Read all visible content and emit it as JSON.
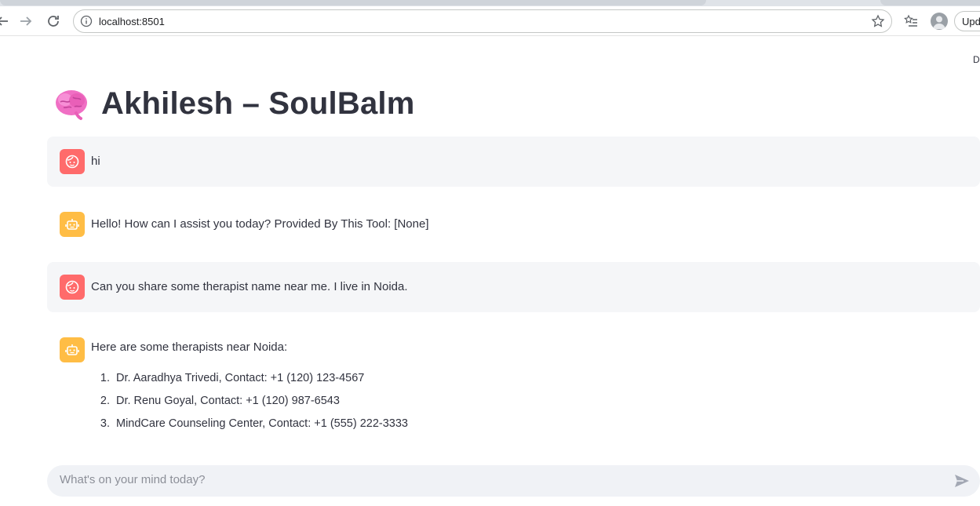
{
  "browser": {
    "url": "localhost:8501",
    "update_label": "Upd"
  },
  "app": {
    "deploy_label": "De",
    "title": "Akhilesh – SoulBalm",
    "title_icon": "brain-emoji"
  },
  "messages": [
    {
      "role": "user",
      "text": "hi"
    },
    {
      "role": "assistant",
      "text": "Hello! How can I assist you today? Provided By This Tool: [None]"
    },
    {
      "role": "user",
      "text": "Can you share some therapist name near me. I live in Noida."
    },
    {
      "role": "assistant",
      "text": "Here are some therapists near Noida:"
    }
  ],
  "therapists": [
    {
      "num": "1.",
      "text": "Dr. Aaradhya Trivedi, Contact: +1 (120) 123-4567"
    },
    {
      "num": "2.",
      "text": "Dr. Renu Goyal, Contact: +1 (120) 987-6543"
    },
    {
      "num": "3.",
      "text": "MindCare Counseling Center, Contact: +1 (555) 222-3333"
    }
  ],
  "chat_input": {
    "placeholder": "What's on your mind today?"
  },
  "colors": {
    "user_avatar": "#ff6b6b",
    "assistant_avatar": "#ffbd45",
    "user_bubble": "#f5f6f8",
    "input_bg": "#f0f2f6",
    "text": "#31333f"
  }
}
